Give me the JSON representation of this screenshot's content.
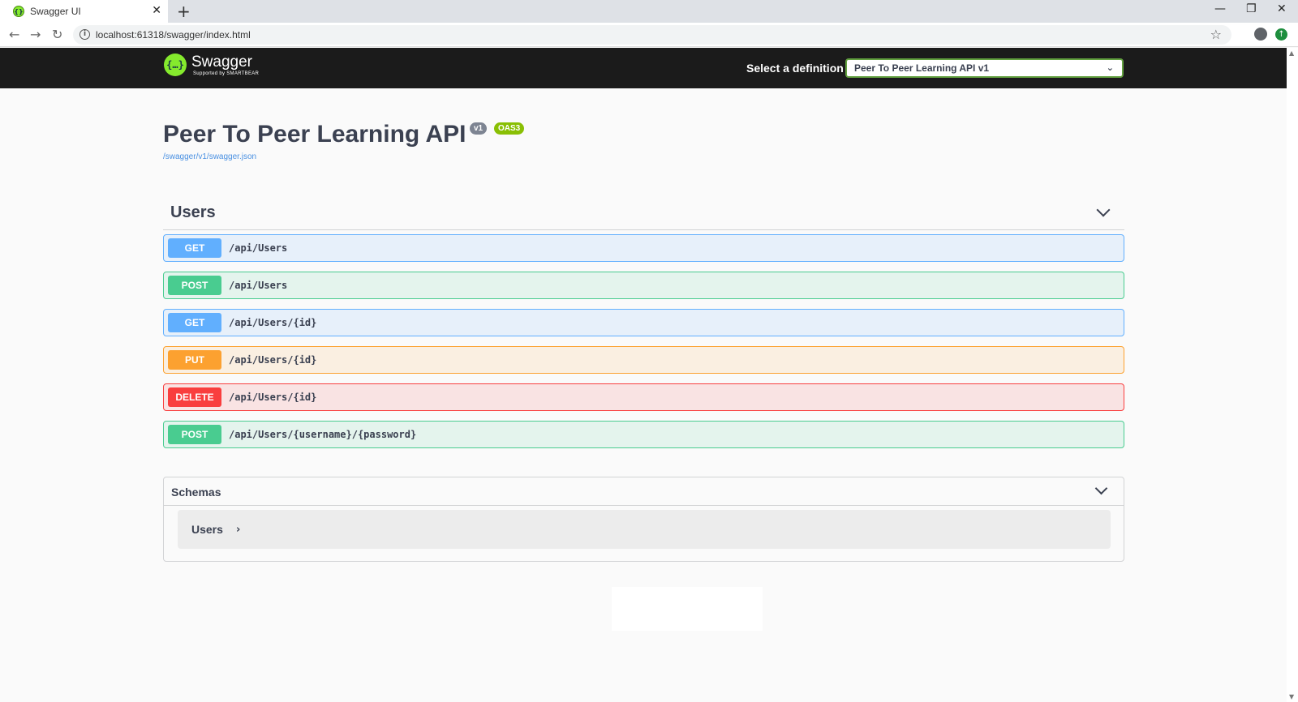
{
  "browser": {
    "tab_title": "Swagger UI",
    "tab_close": "✕",
    "new_tab": "+",
    "url": "localhost:61318/swagger/index.html",
    "window_controls": [
      "—",
      "❐",
      "✕"
    ]
  },
  "topbar": {
    "logo_word": "Swagger",
    "logo_sub": "Supported by SMARTBEAR",
    "definition_label": "Select a definition",
    "definition_selected": "Peer To Peer Learning API v1"
  },
  "info": {
    "title": "Peer To Peer Learning API",
    "version_badge": "v1",
    "oas_badge": "OAS3",
    "spec_link": "/swagger/v1/swagger.json"
  },
  "tag": {
    "name": "Users"
  },
  "operations": [
    {
      "method": "GET",
      "path": "/api/Users"
    },
    {
      "method": "POST",
      "path": "/api/Users"
    },
    {
      "method": "GET",
      "path": "/api/Users/{id}"
    },
    {
      "method": "PUT",
      "path": "/api/Users/{id}"
    },
    {
      "method": "DELETE",
      "path": "/api/Users/{id}"
    },
    {
      "method": "POST",
      "path": "/api/Users/{username}/{password}"
    }
  ],
  "schemas": {
    "title": "Schemas",
    "models": [
      "Users"
    ]
  },
  "colors": {
    "get": "#61affe",
    "post": "#49cc90",
    "put": "#fca130",
    "delete": "#f93e3e",
    "swagger_green": "#85ea2d",
    "topbar": "#1b1b1b"
  }
}
